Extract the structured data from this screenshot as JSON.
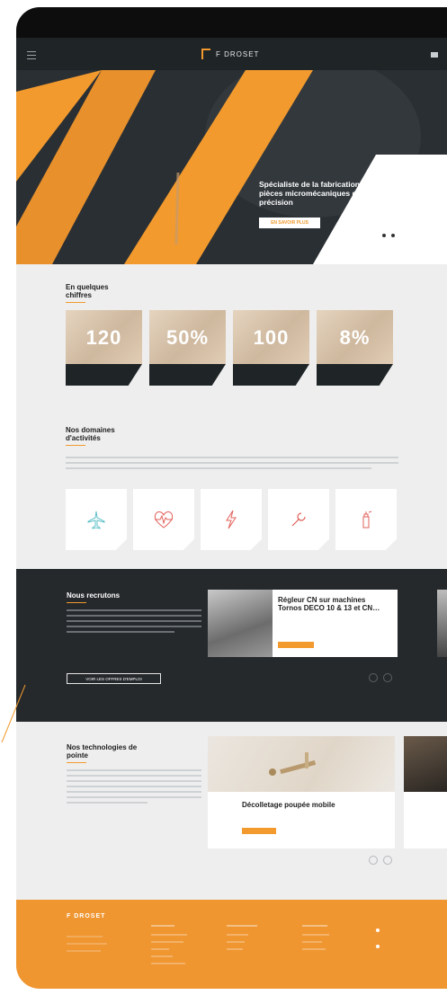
{
  "brand": {
    "name": "F DROSET",
    "accent": "#f29a2e",
    "dark": "#1f2427"
  },
  "nav": {
    "menu_icon": "hamburger-menu-icon",
    "language_icon": "flag-icon"
  },
  "hero": {
    "headline": "Spécialiste de la fabrication de pièces micromécaniques de haute précision",
    "cta": "EN SAVOIR PLUS",
    "slides_total": 2
  },
  "stats": {
    "title": "En quelques chiffres",
    "items": [
      {
        "value": "120",
        "caption": ""
      },
      {
        "value": "50%",
        "caption": ""
      },
      {
        "value": "100",
        "caption": ""
      },
      {
        "value": "8%",
        "caption": ""
      }
    ]
  },
  "domains": {
    "title": "Nos domaines d'activités",
    "icons": [
      "airplane-icon",
      "heart-rate-icon",
      "lightning-icon",
      "wrench-icon",
      "spray-icon"
    ]
  },
  "recruit": {
    "title": "Nous recrutons",
    "job_title": "Régleur CN sur machines Tornos DECO 10 & 13 et CN…",
    "button": "VOIR LES OFFRES D'EMPLOI"
  },
  "technologies": {
    "title": "Nos technologies de pointe",
    "card_title": "Décolletage poupée mobile"
  },
  "footer": {
    "logo": "F DROSET",
    "columns": [
      {
        "title": "",
        "items": [
          "",
          "",
          ""
        ]
      },
      {
        "title": "",
        "items": [
          "",
          "",
          "",
          "",
          "",
          ""
        ]
      },
      {
        "title": "",
        "items": [
          "",
          "",
          "",
          ""
        ]
      },
      {
        "title": "",
        "items": [
          "",
          "",
          "",
          ""
        ]
      }
    ]
  }
}
